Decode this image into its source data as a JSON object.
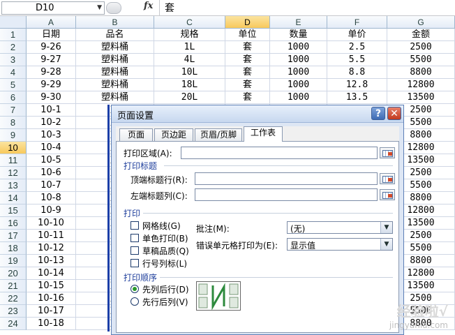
{
  "formula_bar": {
    "name_box": "D10",
    "fx": "fx",
    "formula": "套"
  },
  "columns": [
    "A",
    "B",
    "C",
    "D",
    "E",
    "F",
    "G"
  ],
  "selected_column": "D",
  "selected_row": "10",
  "rows": [
    {
      "n": "1",
      "c": [
        "日期",
        "品名",
        "规格",
        "单位",
        "数量",
        "单价",
        "金额"
      ]
    },
    {
      "n": "2",
      "c": [
        "9-26",
        "塑料桶",
        "1L",
        "套",
        "1000",
        "2.5",
        "2500"
      ]
    },
    {
      "n": "3",
      "c": [
        "9-27",
        "塑料桶",
        "4L",
        "套",
        "1000",
        "5.5",
        "5500"
      ]
    },
    {
      "n": "4",
      "c": [
        "9-28",
        "塑料桶",
        "10L",
        "套",
        "1000",
        "8.8",
        "8800"
      ]
    },
    {
      "n": "5",
      "c": [
        "9-29",
        "塑料桶",
        "18L",
        "套",
        "1000",
        "12.8",
        "12800"
      ]
    },
    {
      "n": "6",
      "c": [
        "9-30",
        "塑料桶",
        "20L",
        "套",
        "1000",
        "13.5",
        "13500"
      ]
    },
    {
      "n": "7",
      "c": [
        "10-1",
        "塑",
        "",
        "",
        "",
        "",
        "2500"
      ]
    },
    {
      "n": "8",
      "c": [
        "10-2",
        "塑",
        "",
        "",
        "",
        "",
        "5500"
      ]
    },
    {
      "n": "9",
      "c": [
        "10-3",
        "塑",
        "",
        "",
        "",
        "",
        "8800"
      ]
    },
    {
      "n": "10",
      "c": [
        "10-4",
        "塑",
        "",
        "",
        "",
        "",
        "12800"
      ]
    },
    {
      "n": "11",
      "c": [
        "10-5",
        "塑",
        "",
        "",
        "",
        "",
        "13500"
      ]
    },
    {
      "n": "12",
      "c": [
        "10-6",
        "塑",
        "",
        "",
        "",
        "",
        "2500"
      ]
    },
    {
      "n": "13",
      "c": [
        "10-7",
        "塑",
        "",
        "",
        "",
        "",
        "5500"
      ]
    },
    {
      "n": "14",
      "c": [
        "10-8",
        "塑",
        "",
        "",
        "",
        "",
        "8800"
      ]
    },
    {
      "n": "15",
      "c": [
        "10-9",
        "塑",
        "",
        "",
        "",
        "",
        "12800"
      ]
    },
    {
      "n": "16",
      "c": [
        "10-10",
        "塑",
        "",
        "",
        "",
        "",
        "13500"
      ]
    },
    {
      "n": "17",
      "c": [
        "10-11",
        "塑",
        "",
        "",
        "",
        "",
        "2500"
      ]
    },
    {
      "n": "18",
      "c": [
        "10-12",
        "塑",
        "",
        "",
        "",
        "",
        "5500"
      ]
    },
    {
      "n": "19",
      "c": [
        "10-13",
        "塑",
        "",
        "",
        "",
        "",
        "8800"
      ]
    },
    {
      "n": "20",
      "c": [
        "10-14",
        "塑",
        "",
        "",
        "",
        "",
        "12800"
      ]
    },
    {
      "n": "21",
      "c": [
        "10-15",
        "塑",
        "",
        "",
        "",
        "",
        "13500"
      ]
    },
    {
      "n": "22",
      "c": [
        "10-16",
        "塑",
        "",
        "",
        "",
        "",
        "2500"
      ]
    },
    {
      "n": "23",
      "c": [
        "10-17",
        "塑",
        "",
        "",
        "",
        "",
        "5500"
      ]
    },
    {
      "n": "24",
      "c": [
        "10-18",
        "塑",
        "",
        "",
        "",
        "",
        "8800"
      ]
    }
  ],
  "dialog": {
    "title": "页面设置",
    "help": "?",
    "close": "✕",
    "tabs": [
      "页面",
      "页边距",
      "页眉/页脚",
      "工作表"
    ],
    "active_tab": "工作表",
    "print_area_label": "打印区域(A):",
    "print_titles_section": "打印标题",
    "top_rows_label": "顶端标题行(R):",
    "left_cols_label": "左端标题列(C):",
    "print_section": "打印",
    "checks": [
      "网格线(G)",
      "单色打印(B)",
      "草稿品质(Q)",
      "行号列标(L)"
    ],
    "comments_label": "批注(M):",
    "comments_value": "(无)",
    "errors_label": "错误单元格打印为(E):",
    "errors_value": "显示值",
    "order_section": "打印顺序",
    "order_options": [
      "先列后行(D)",
      "先行后列(V)"
    ]
  },
  "watermark": {
    "line1": "经验啦√",
    "line2": "jingyanla.com"
  }
}
